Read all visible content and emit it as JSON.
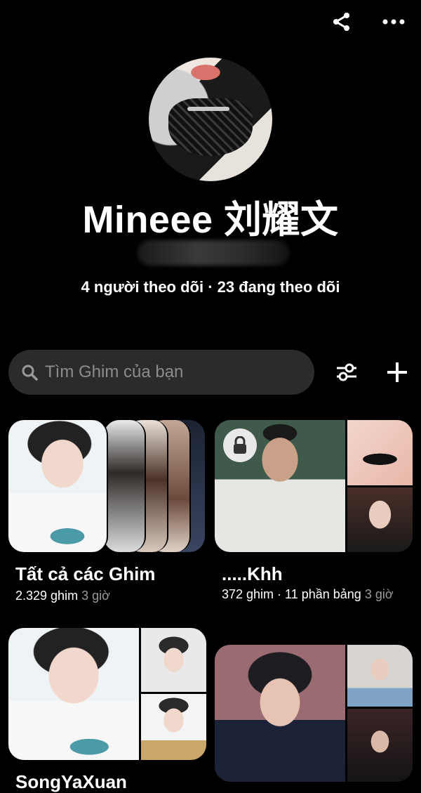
{
  "header": {
    "share_icon": "share-icon",
    "more_icon": "more-horizontal-icon"
  },
  "profile": {
    "display_name": "Mineee 刘耀文",
    "followers": "4 người theo dõi",
    "separator": " · ",
    "following": "23 đang theo dõi"
  },
  "search": {
    "placeholder": "Tìm Ghim của bạn"
  },
  "boards": [
    {
      "title": "Tất cả các Ghim",
      "pins": "2.329 ghim",
      "time": "3 giờ",
      "locked": false
    },
    {
      "title": ".....Khh",
      "pins": "372 ghim · 11 phần bảng",
      "time": "3 giờ",
      "locked": true
    },
    {
      "title": "SongYaXuan",
      "locked": false
    },
    {
      "locked": false
    }
  ],
  "colors": {
    "background": "#000000",
    "search_bg": "#2b2b2b",
    "muted_text": "#9a9a9a"
  }
}
